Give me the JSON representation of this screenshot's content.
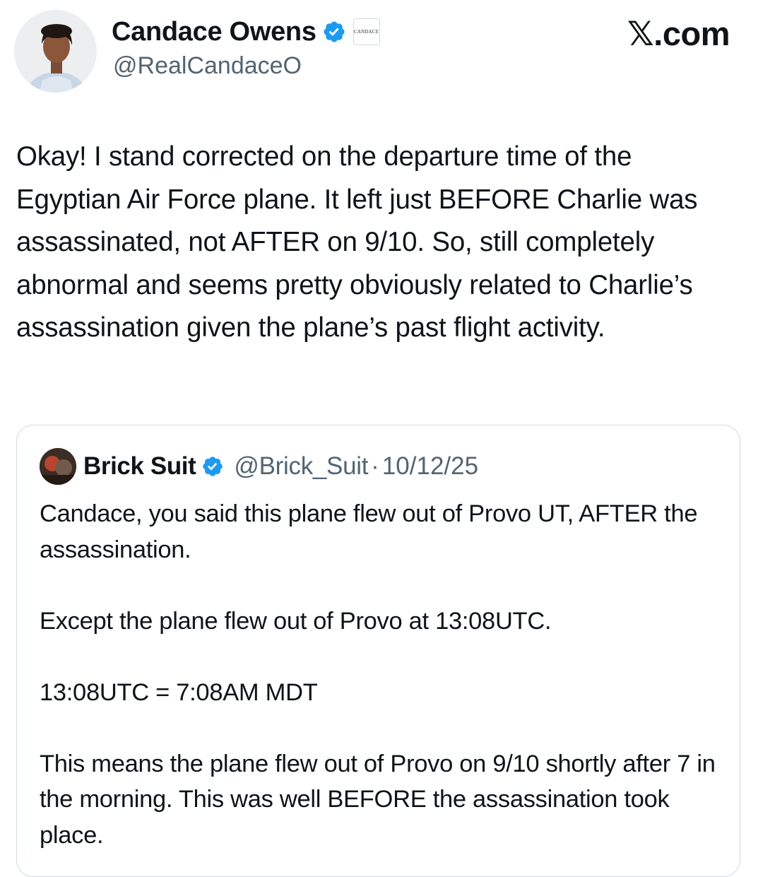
{
  "author": {
    "display_name": "Candace Owens",
    "handle": "@RealCandaceO",
    "affiliate_badge_text": "CANDACE",
    "avatar_icon": "profile-photo",
    "verified_icon": "verified-badge-icon"
  },
  "site_label": {
    "x": "𝕏",
    "rest": ".com"
  },
  "tweet": {
    "text": "Okay! I stand corrected on the departure time of the Egyptian Air Force plane. It left just BEFORE Charlie was assassinated, not AFTER on 9/10. So, still completely abnormal and seems pretty obviously related to Charlie’s assassination given the plane’s past flight activity."
  },
  "quoted_tweet": {
    "display_name": "Brick Suit",
    "handle": "@Brick_Suit",
    "separator": "·",
    "date": "10/12/25",
    "text": "Candace, you said this plane flew out of Provo UT, AFTER the assassination.\n\nExcept the plane flew out of Provo at 13:08UTC.\n\n13:08UTC = 7:08AM MDT\n\nThis means the plane flew out of Provo on 9/10 shortly after 7 in the morning. This was well BEFORE the assassination took place."
  },
  "colors": {
    "verified_blue": "#1d9bf0",
    "secondary_text": "#536471",
    "primary_text": "#0f1419",
    "border": "#cfd9de"
  }
}
